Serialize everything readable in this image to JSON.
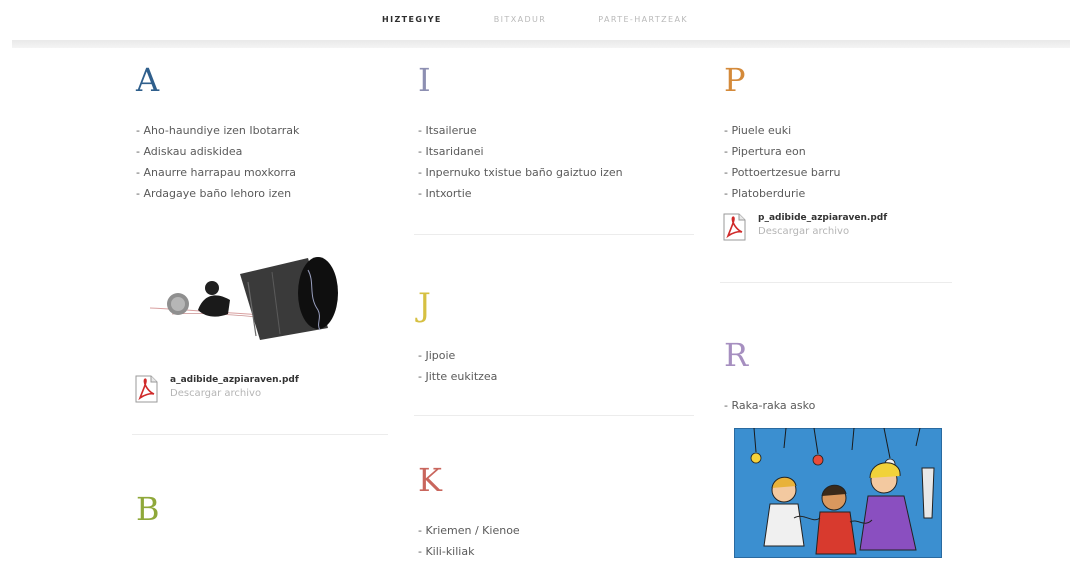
{
  "nav": {
    "items": [
      {
        "label": "HIZTEGIYE",
        "active": true
      },
      {
        "label": "BITXADUR"
      },
      {
        "label": "PARTE-HARTZEAK"
      }
    ]
  },
  "colors": {
    "A": "#2f5f8c",
    "B": "#8fa83a",
    "I": "#8d8fb2",
    "J": "#d6c042",
    "K": "#c9665d",
    "P": "#d48a3a",
    "R": "#a68fc0"
  },
  "columns": [
    {
      "sections": [
        {
          "letter": "A",
          "items": [
            "- Aho-haundiye izen Ibotarrak",
            "- Adiskau adiskidea",
            "- Anaurre harrapau moxkorra",
            "- Ardagaye baño lehoro izen"
          ],
          "image": "lying-can-illustration",
          "attachment": {
            "filename": "a_adibide_azpiaraven.pdf",
            "action": "Descargar archivo"
          }
        },
        {
          "letter": "B",
          "items": []
        }
      ]
    },
    {
      "sections": [
        {
          "letter": "I",
          "items": [
            "- Itsailerue",
            "- Itsaridanei",
            "- Inpernuko txistue baño gaiztuo izen",
            "- Intxortie"
          ]
        },
        {
          "letter": "J",
          "items": [
            "- Jipoie",
            "- Jitte eukitzea"
          ]
        },
        {
          "letter": "K",
          "items": [
            "- Kriemen / Kienoe",
            "- Kili-kiliak"
          ]
        }
      ]
    },
    {
      "sections": [
        {
          "letter": "P",
          "items": [
            "- Piuele euki",
            "- Pipertura eon",
            "- Pottoertzesue barru",
            "- Platoberdurie"
          ],
          "attachment": {
            "filename": "p_adibide_azpiaraven.pdf",
            "action": "Descargar archivo"
          }
        },
        {
          "letter": "R",
          "items": [
            "- Raka-raka asko"
          ],
          "image": "children-drawing"
        }
      ]
    }
  ]
}
